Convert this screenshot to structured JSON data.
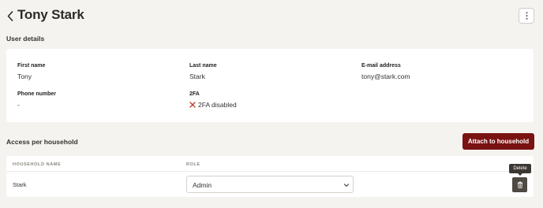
{
  "header": {
    "title": "Tony Stark",
    "back_icon": "chevron-left-icon",
    "menu_icon": "kebab-menu-icon"
  },
  "user_details": {
    "section_title": "User details",
    "fields": {
      "first_name": {
        "label": "First name",
        "value": "Tony"
      },
      "last_name": {
        "label": "Last name",
        "value": "Stark"
      },
      "email": {
        "label": "E-mail address",
        "value": "tony@stark.com"
      },
      "phone": {
        "label": "Phone number",
        "value": "-"
      },
      "twofa": {
        "label": "2FA",
        "value": "2FA disabled",
        "icon": "x-icon",
        "icon_color": "#c0392b"
      }
    }
  },
  "households": {
    "section_title": "Access per household",
    "attach_button_label": "Attach to household",
    "columns": {
      "name": "HOUSEHOLD NAME",
      "role": "ROLE"
    },
    "rows": [
      {
        "name": "Stark",
        "role": "Admin"
      }
    ],
    "delete_tooltip": "Delete"
  },
  "colors": {
    "accent": "#7a1212",
    "background": "#f4f3ef",
    "delete_button": "#4f4943"
  }
}
